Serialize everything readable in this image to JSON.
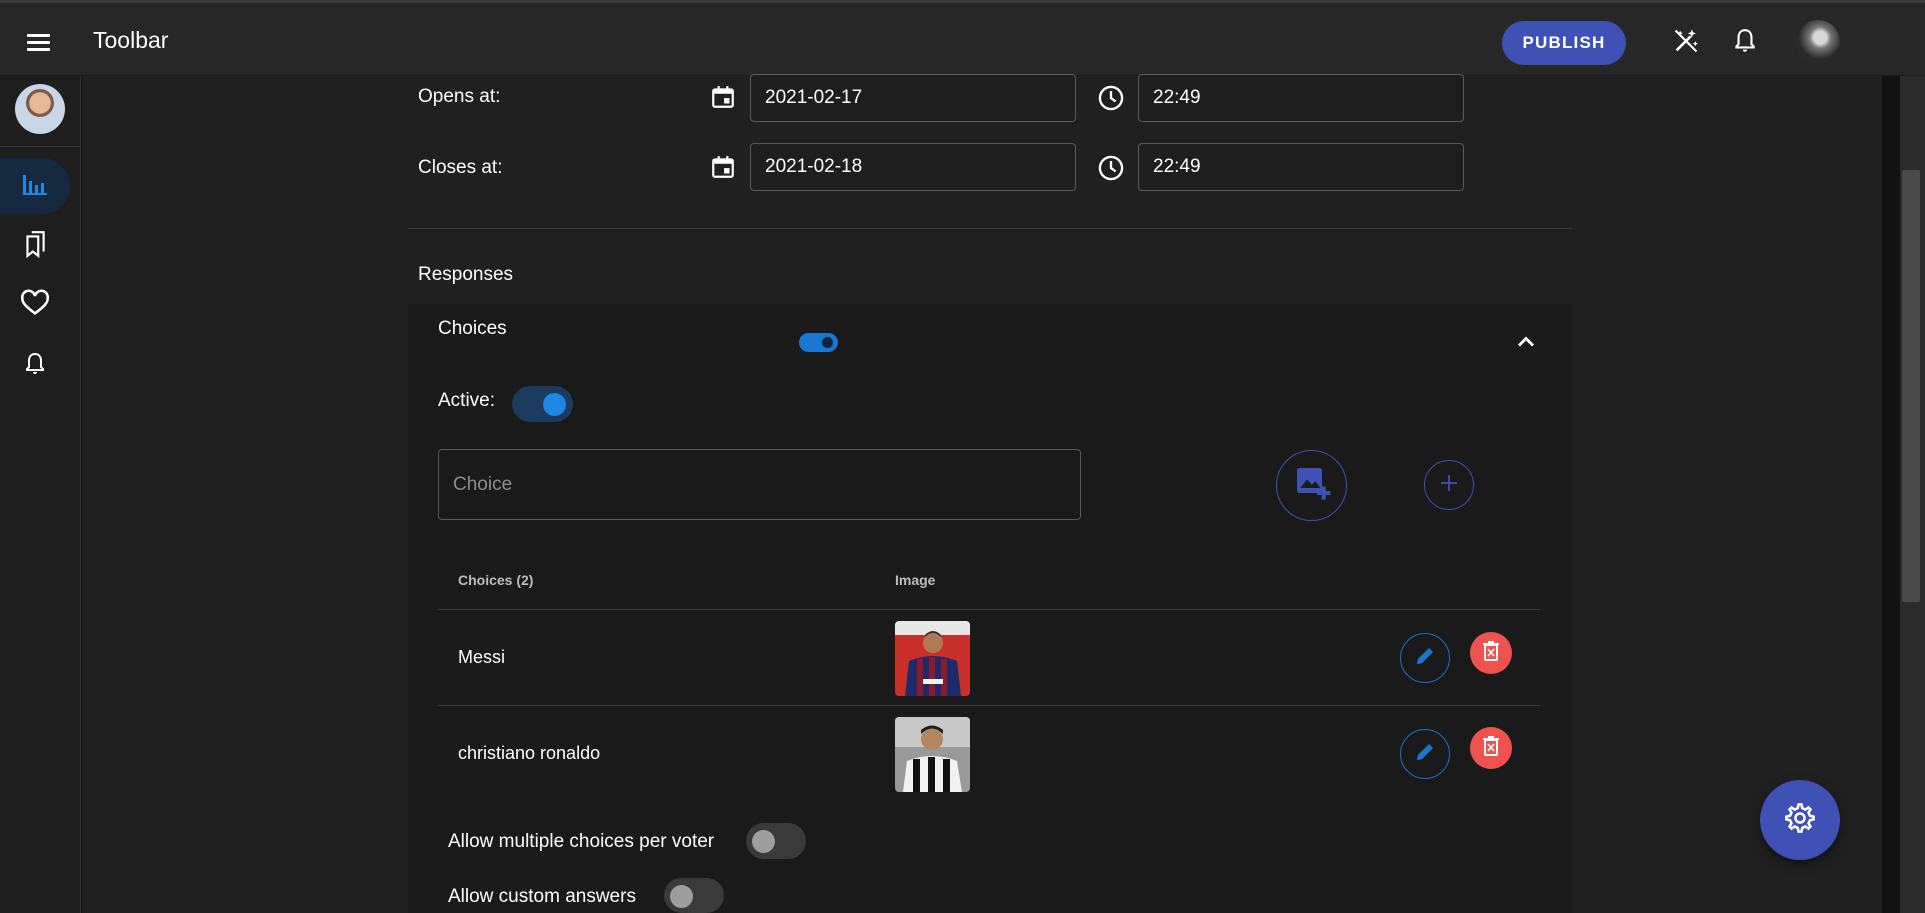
{
  "toolbar": {
    "title": "Toolbar",
    "publish_label": "PUBLISH",
    "icons": [
      "menu-icon",
      "magic-wand-icon",
      "bell-icon",
      "user-avatar"
    ]
  },
  "rail": {
    "items": [
      "analytics-icon",
      "bookmarks-icon",
      "heart-icon",
      "bell-icon"
    ],
    "active_index": 0
  },
  "schedule": {
    "opens_label": "Opens at:",
    "opens_date": "2021-02-17",
    "opens_time": "22:49",
    "closes_label": "Closes at:",
    "closes_date": "2021-02-18",
    "closes_time": "22:49"
  },
  "responses": {
    "title": "Responses",
    "section_title": "Choices",
    "section_enabled": true,
    "active_label": "Active:",
    "active": true,
    "choice_placeholder": "Choice",
    "table": {
      "headers": [
        "Choices (2)",
        "Image"
      ],
      "rows": [
        {
          "name": "Messi",
          "image": "messi-photo"
        },
        {
          "name": "christiano ronaldo",
          "image": "ronaldo-photo"
        }
      ]
    },
    "allow_multiple_label": "Allow multiple choices per voter",
    "allow_multiple": false,
    "allow_custom_label": "Allow custom answers",
    "allow_custom": false
  },
  "colors": {
    "primary": "#3f51b5",
    "accent_blue": "#1976d2",
    "danger": "#ef5350",
    "background": "#202020"
  }
}
